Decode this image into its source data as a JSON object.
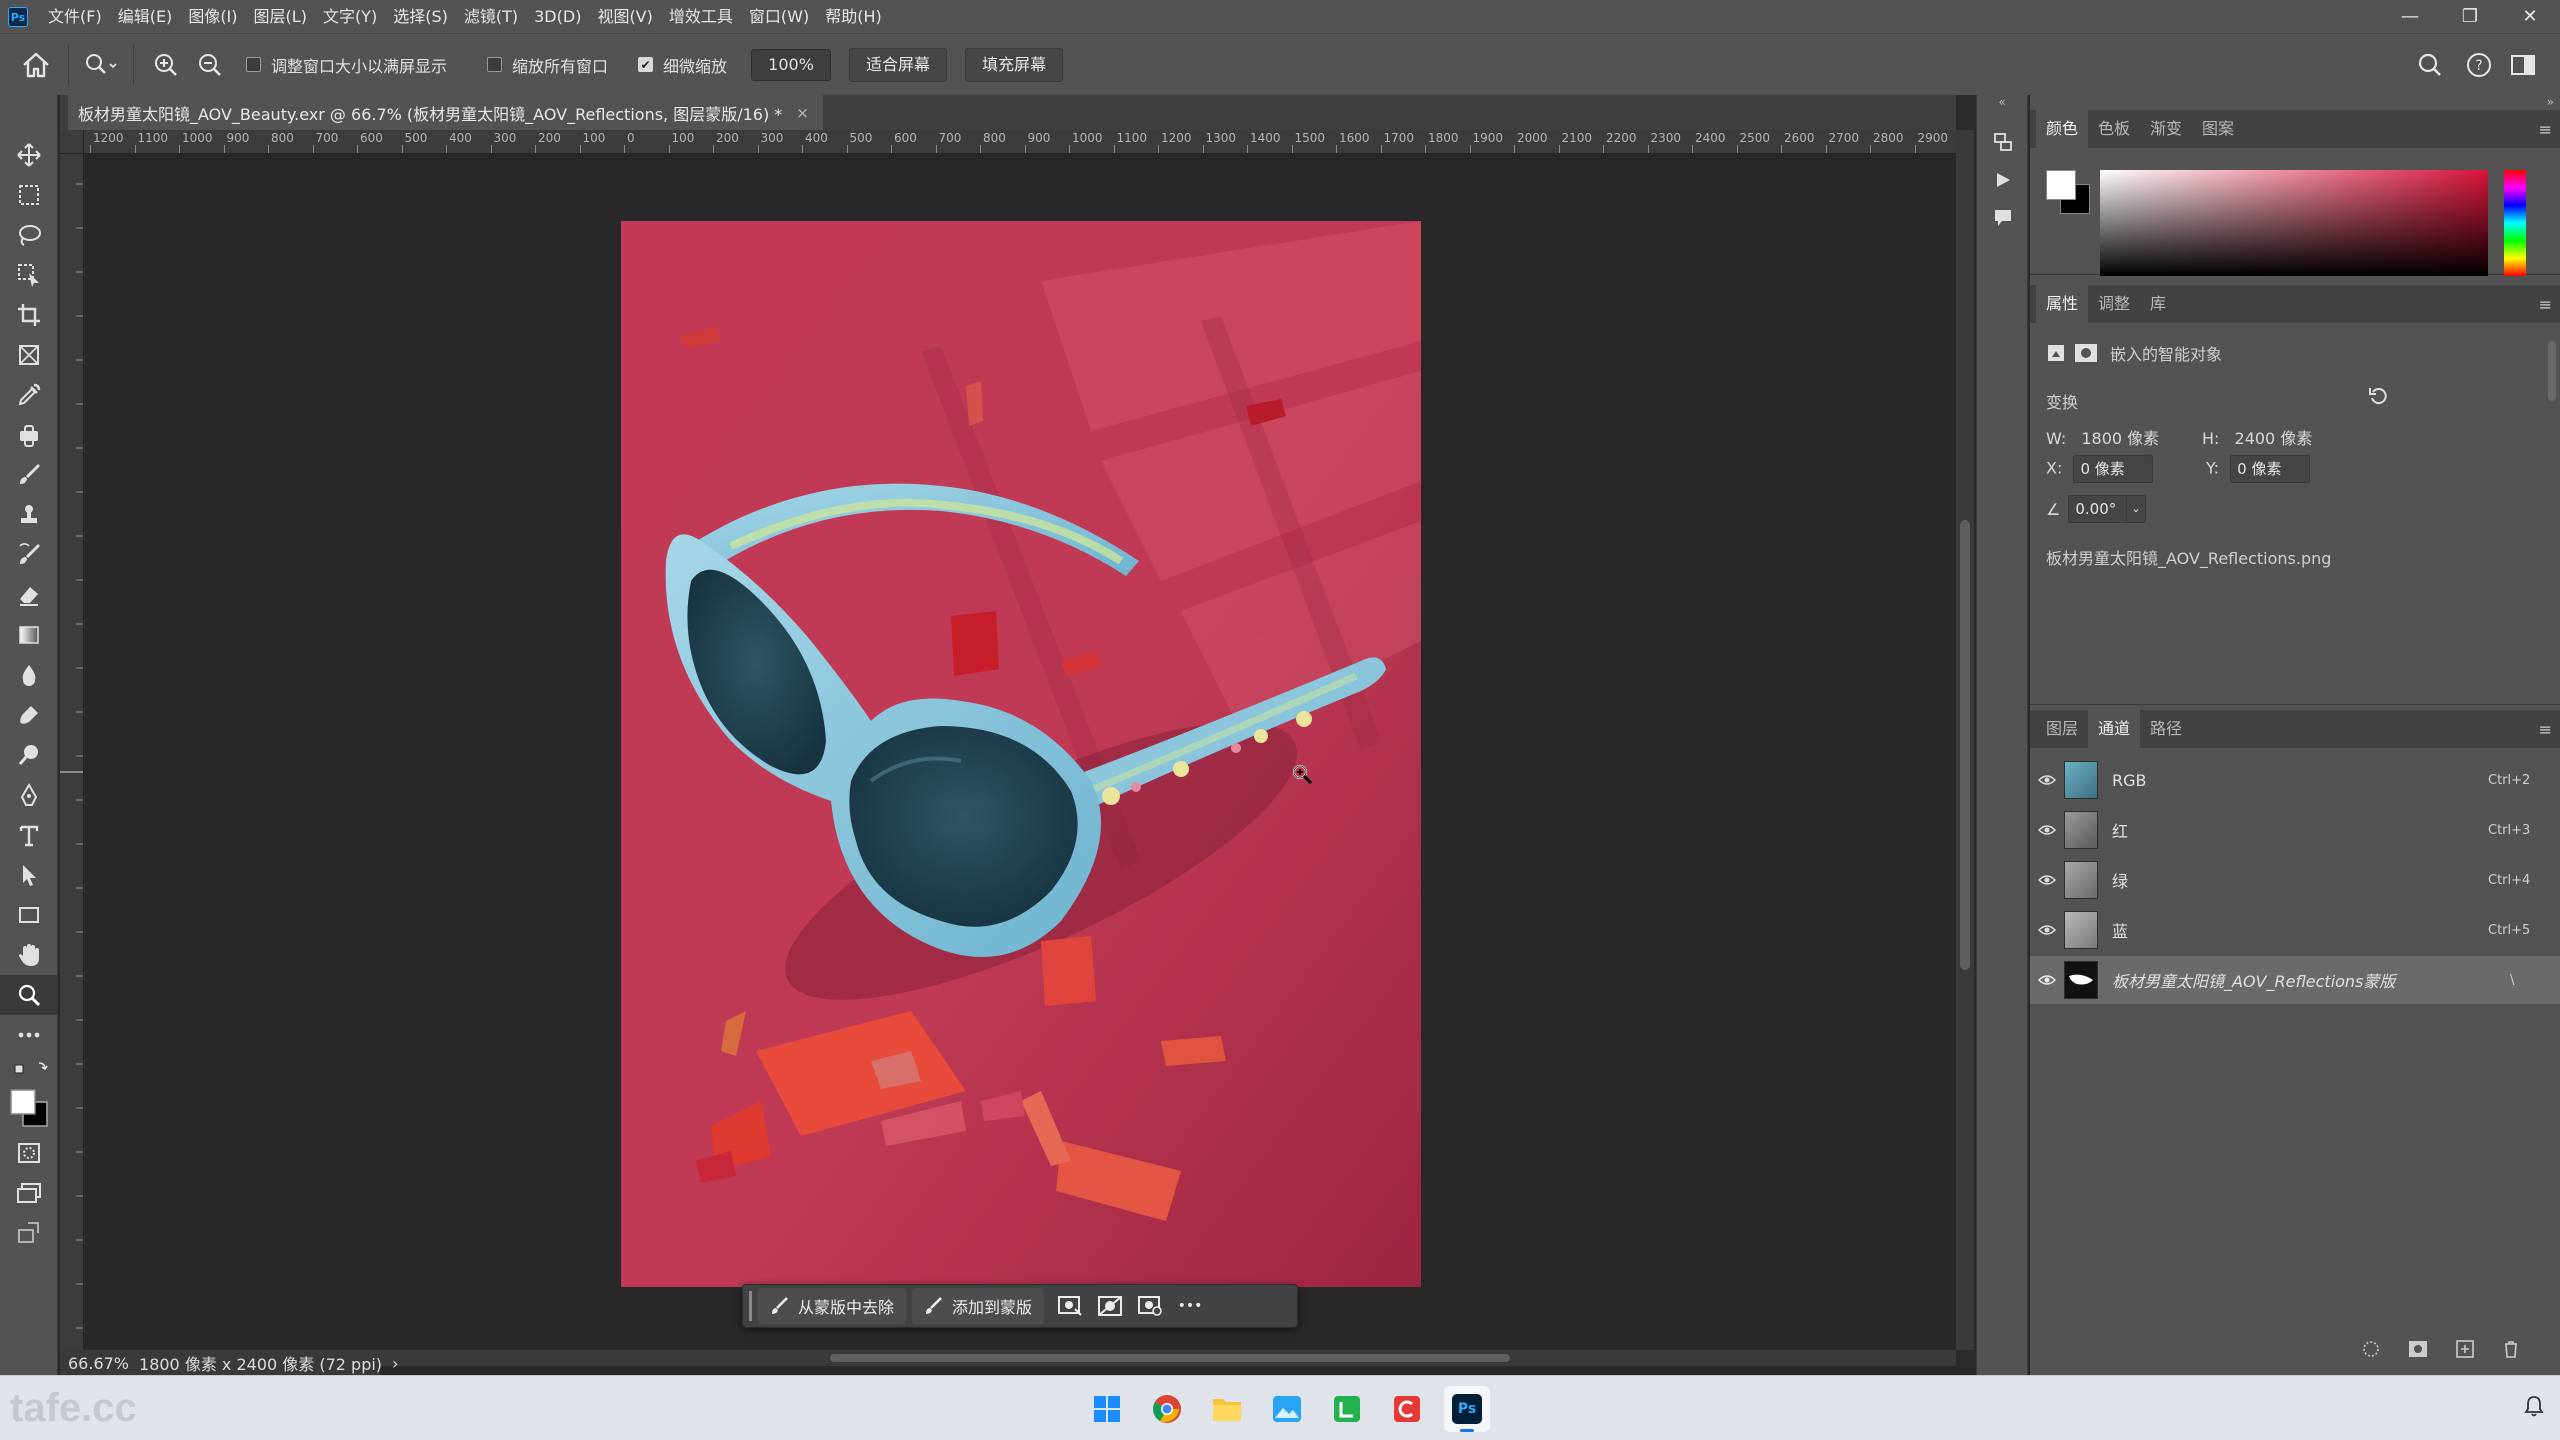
{
  "app": {
    "logo": "Ps",
    "menu": [
      "文件(F)",
      "编辑(E)",
      "图像(I)",
      "图层(L)",
      "文字(Y)",
      "选择(S)",
      "滤镜(T)",
      "3D(D)",
      "视图(V)",
      "增效工具",
      "窗口(W)",
      "帮助(H)"
    ],
    "window_controls": {
      "minimize": "—",
      "restore": "❐",
      "close": "✕"
    }
  },
  "options_bar": {
    "resize_windows": {
      "label": "调整窗口大小以满屏显示",
      "checked": false
    },
    "zoom_all": {
      "label": "缩放所有窗口",
      "checked": false
    },
    "scrubby_zoom": {
      "label": "细微缩放",
      "checked": true
    },
    "zoom_value": "100%",
    "fit_screen": "适合屏幕",
    "fill_screen": "填充屏幕"
  },
  "document": {
    "tab_title": "板材男童太阳镜_AOV_Beauty.exr @ 66.7% (板材男童太阳镜_AOV_Reflections, 图层蒙版/16) *",
    "close": "×"
  },
  "ruler": {
    "top_labels": [
      "1200",
      "1100",
      "1000",
      "900",
      "800",
      "700",
      "600",
      "500",
      "400",
      "300",
      "200",
      "100",
      "0",
      "100",
      "200",
      "300",
      "400",
      "500",
      "600",
      "700",
      "800",
      "900",
      "1000",
      "1100",
      "1200",
      "1300",
      "1400",
      "1500",
      "1600",
      "1700",
      "1800",
      "1900",
      "2000",
      "2100",
      "2200",
      "2300",
      "2400",
      "2500",
      "2600",
      "2700",
      "2800",
      "2900"
    ]
  },
  "status": {
    "zoom": "66.67%",
    "info": "1800 像素 x 2400 像素 (72 ppi)",
    "arrow": "›"
  },
  "context_bar": {
    "subtract": "从蒙版中去除",
    "add": "添加到蒙版",
    "more": "•••"
  },
  "color_panel": {
    "tabs": [
      "颜色",
      "色板",
      "渐变",
      "图案"
    ],
    "foreground": "#ffffff",
    "background": "#000000",
    "hue": "#d9143a"
  },
  "properties_panel": {
    "tabs": [
      "属性",
      "调整",
      "库"
    ],
    "object_type": "嵌入的智能对象",
    "section": "变换",
    "w_label": "W:",
    "w_value": "1800 像素",
    "h_label": "H:",
    "h_value": "2400 像素",
    "x_label": "X:",
    "x_value": "0 像素",
    "y_label": "Y:",
    "y_value": "0 像素",
    "angle": "0.00°",
    "linked_file": "板材男童太阳镜_AOV_Reflections.png"
  },
  "channels_panel": {
    "tabs": [
      "图层",
      "通道",
      "路径"
    ],
    "channels": [
      {
        "name": "RGB",
        "shortcut": "Ctrl+2"
      },
      {
        "name": "红",
        "shortcut": "Ctrl+3"
      },
      {
        "name": "绿",
        "shortcut": "Ctrl+4"
      },
      {
        "name": "蓝",
        "shortcut": "Ctrl+5"
      },
      {
        "name": "板材男童太阳镜_AOV_Reflections蒙版",
        "shortcut": "\\"
      }
    ]
  },
  "taskbar": {
    "watermark": "tafe.cc",
    "apps": [
      "start",
      "chrome",
      "file-explorer",
      "photos",
      "green-app",
      "red-app",
      "photoshop"
    ],
    "ps_label": "Ps"
  }
}
